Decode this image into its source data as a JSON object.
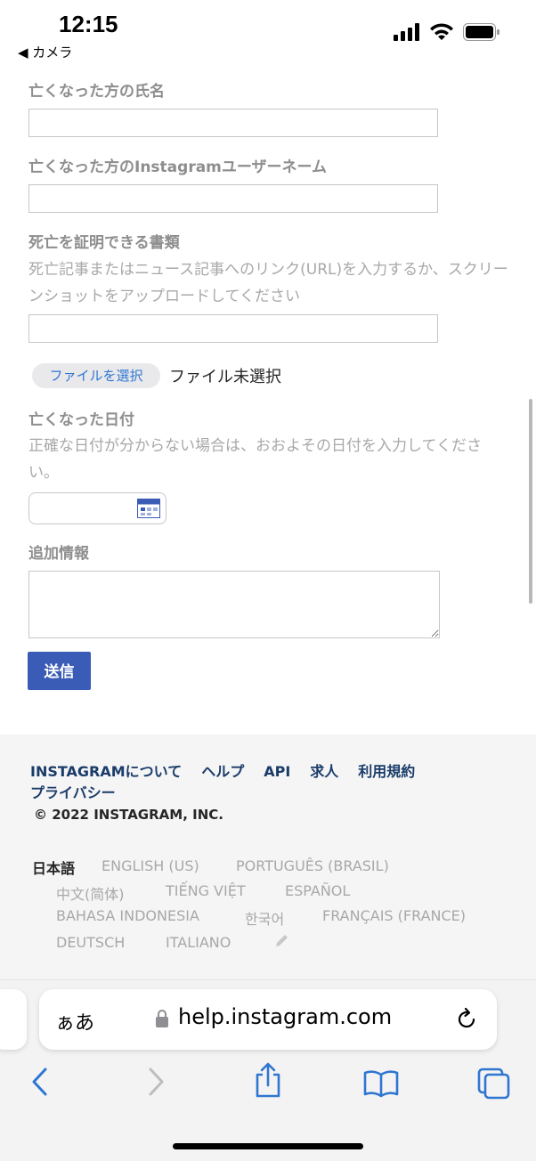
{
  "status": {
    "time": "12:15",
    "back_label": "◀ カメラ"
  },
  "form": {
    "name_label": "亡くなった方の氏名",
    "username_label": "亡くなった方のInstagramユーザーネーム",
    "proof_label": "死亡を証明できる書類",
    "proof_desc": "死亡記事またはニュース記事へのリンク(URL)を入力するか、スクリーンショットをアップロードしてください",
    "file_button": "ファイルを選択",
    "file_none": "ファイル未選択",
    "date_label": "亡くなった日付",
    "date_desc": "正確な日付が分からない場合は、おおよその日付を入力してください。",
    "extra_label": "追加情報",
    "submit": "送信"
  },
  "footer": {
    "links": [
      "INSTAGRAMについて",
      "ヘルプ",
      "API",
      "求人",
      "利用規約",
      "プライバシー"
    ],
    "copyright": "© 2022 INSTAGRAM, INC.",
    "languages": [
      "日本語",
      "ENGLISH (US)",
      "PORTUGUÊS (BRASIL)",
      "中文(简体)",
      "TIẾNG VIỆT",
      "ESPAÑOL",
      "BAHASA INDONESIA",
      "한국어",
      "FRANÇAIS (FRANCE)",
      "DEUTSCH",
      "ITALIANO"
    ],
    "active_language": "日本語"
  },
  "browser": {
    "aa": "ぁあ",
    "url": "help.instagram.com"
  },
  "colors": {
    "accent": "#3b5cb6",
    "link": "#1a3c6a",
    "ios_blue": "#2f76d2"
  }
}
